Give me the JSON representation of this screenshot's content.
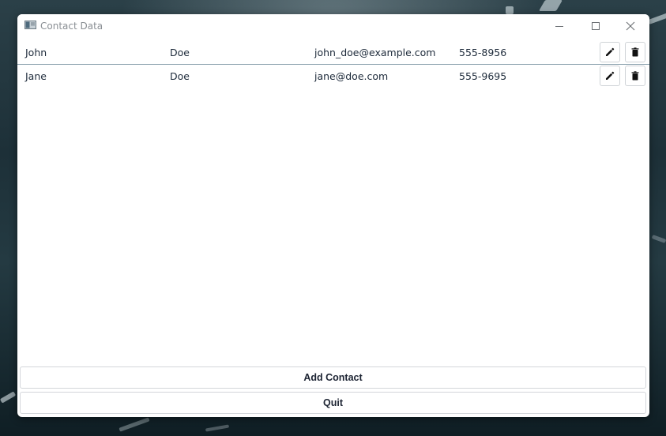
{
  "window": {
    "title": "Contact Data"
  },
  "contacts": [
    {
      "first_name": "John",
      "last_name": "Doe",
      "email": "john_doe@example.com",
      "phone": "555-8956"
    },
    {
      "first_name": "Jane",
      "last_name": "Doe",
      "email": "jane@doe.com",
      "phone": "555-9695"
    }
  ],
  "actions": {
    "add_label": "Add Contact",
    "quit_label": "Quit"
  },
  "icons": {
    "edit": "pencil-icon",
    "delete": "trash-icon",
    "minimize": "minimize-icon",
    "maximize": "maximize-icon",
    "close": "close-icon"
  },
  "colors": {
    "row_separator": "#8fa4b0",
    "text": "#1d2a3a",
    "title_text": "#8a8f94"
  }
}
